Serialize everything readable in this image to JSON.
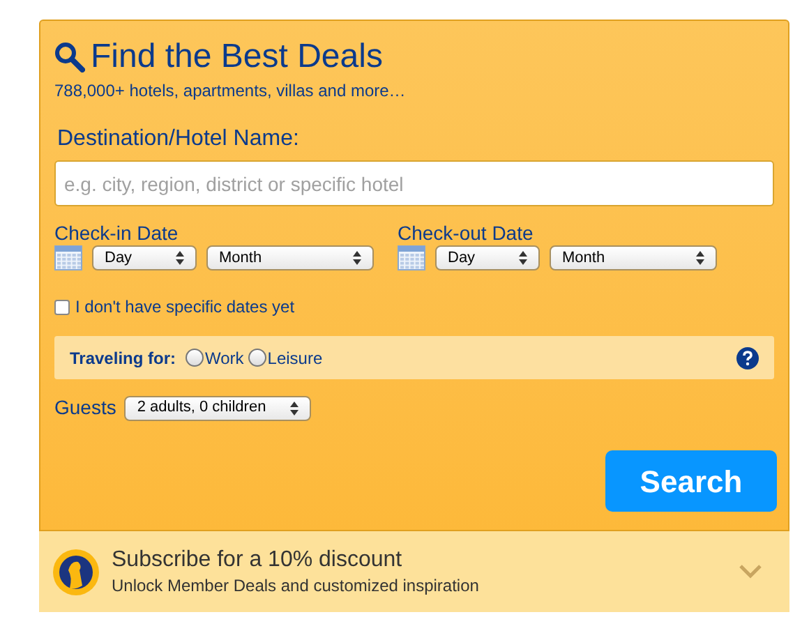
{
  "header": {
    "title": "Find the Best Deals",
    "subtitle": "788,000+ hotels, apartments, villas and more…"
  },
  "destination": {
    "label": "Destination/Hotel Name:",
    "placeholder": "e.g. city, region, district or specific hotel"
  },
  "dates": [
    {
      "label": "Check-in Date",
      "day": "Day",
      "month": "Month"
    },
    {
      "label": "Check-out Date",
      "day": "Day",
      "month": "Month"
    }
  ],
  "no_dates": {
    "label": "I don't have specific dates yet",
    "checked": false
  },
  "traveling": {
    "label": "Traveling for:",
    "options": [
      {
        "label": "Work",
        "selected": false
      },
      {
        "label": "Leisure",
        "selected": false
      }
    ]
  },
  "guests": {
    "label": "Guests",
    "value": "2 adults, 0 children"
  },
  "search_button": "Search",
  "subscribe": {
    "title": "Subscribe for a 10% discount",
    "subtitle": "Unlock Member Deals and customized inspiration",
    "expanded": false
  }
}
